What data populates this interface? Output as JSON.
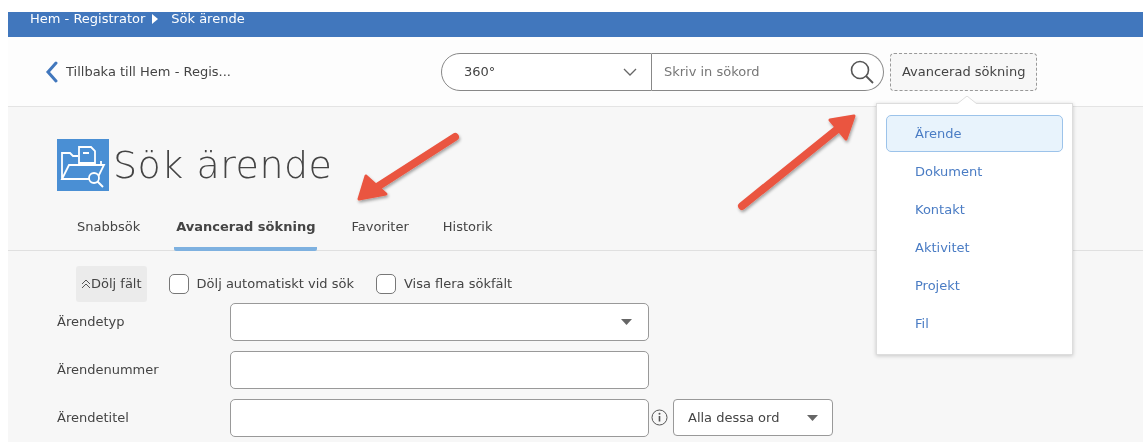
{
  "breadcrumb": [
    {
      "label": "Hem - Registrator"
    },
    {
      "label": "Sök ärende"
    }
  ],
  "back_link": "Tillbaka till Hem - Regis...",
  "search": {
    "scope": "360°",
    "placeholder": "Skriv in sökord"
  },
  "advanced_button": {
    "label": "Avancerad sökning",
    "expanded": true
  },
  "menu": [
    {
      "label": "Ärende",
      "selected": true
    },
    {
      "label": "Dokument",
      "selected": false
    },
    {
      "label": "Kontakt",
      "selected": false
    },
    {
      "label": "Aktivitet",
      "selected": false
    },
    {
      "label": "Projekt",
      "selected": false
    },
    {
      "label": "Fil",
      "selected": false
    }
  ],
  "title": "Sök ärende",
  "tabs": [
    {
      "label": "Snabbsök",
      "selected": false
    },
    {
      "label": "Avancerad sökning",
      "selected": true
    },
    {
      "label": "Favoriter",
      "selected": false
    },
    {
      "label": "Historik",
      "selected": false
    }
  ],
  "hide_fields_button": "Dölj fält",
  "options": [
    {
      "label": "Dölj automatiskt vid sök",
      "checked": false
    },
    {
      "label": "Visa flera sökfält",
      "checked": false
    }
  ],
  "fields": [
    {
      "label": "Ärendetyp",
      "kind": "select"
    },
    {
      "label": "Ärendenummer",
      "kind": "text"
    },
    {
      "label": "Ärendetitel",
      "kind": "text_mode",
      "mode": "Alla dessa ord"
    }
  ]
}
